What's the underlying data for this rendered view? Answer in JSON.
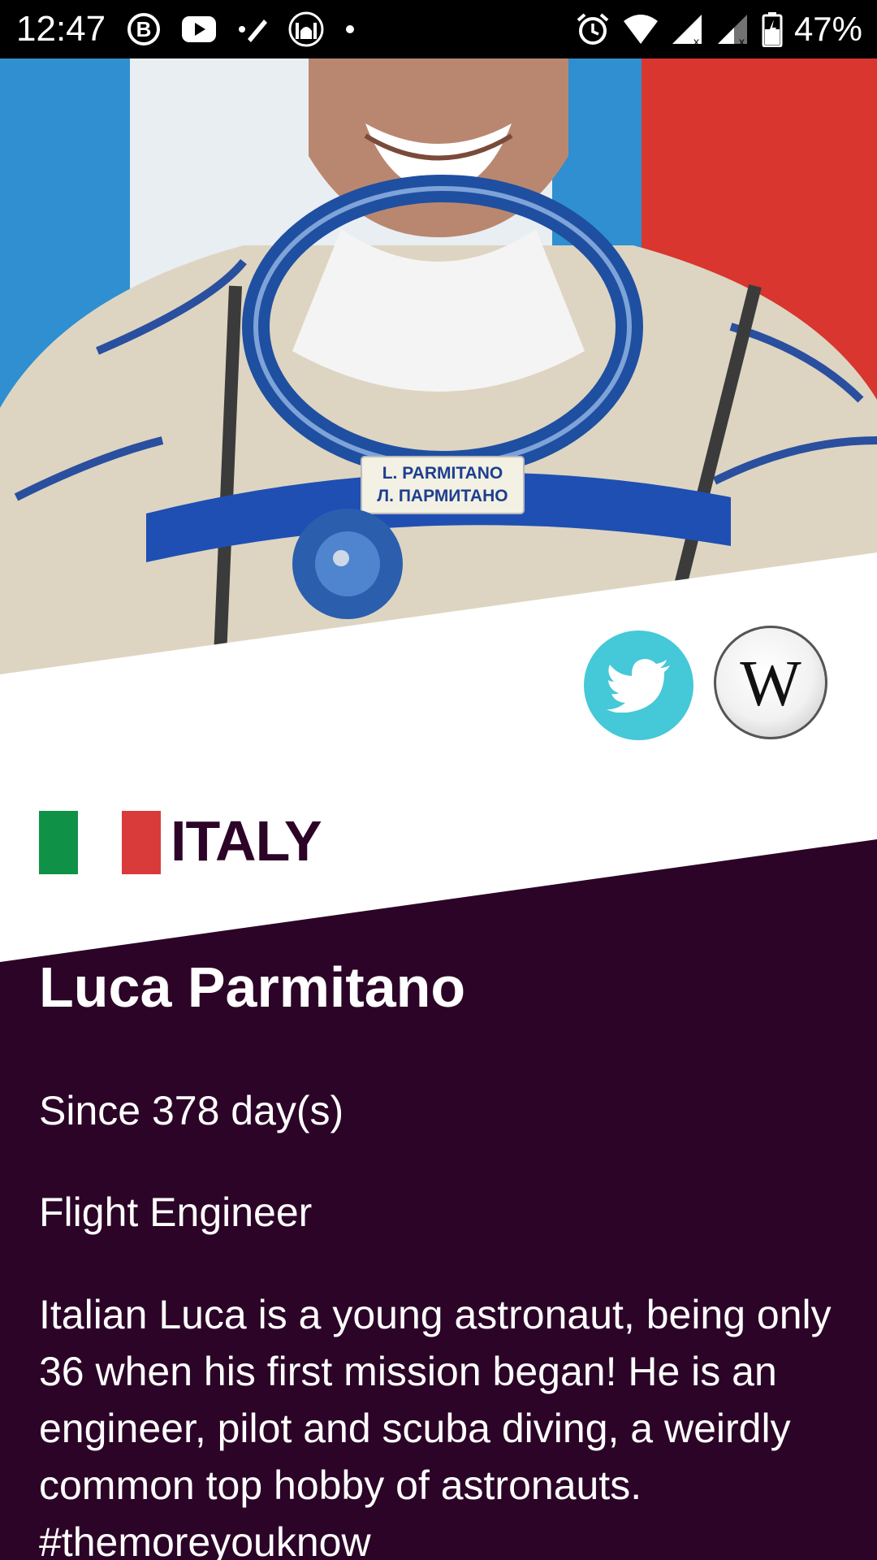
{
  "status_bar": {
    "time": "12:47",
    "battery": "47%",
    "left_icons": [
      "b-badge-icon",
      "youtube-icon",
      "pen-icon",
      "mosque-icon",
      "dot-icon"
    ],
    "right_icons": [
      "alarm-icon",
      "wifi-icon",
      "signal-icon",
      "signal-icon",
      "battery-icon"
    ]
  },
  "hero": {
    "nametag_line1": "L. PARMITANO",
    "nametag_line2": "Л. ПАРМИТАНО"
  },
  "social": {
    "twitter_icon": "twitter-bird-icon",
    "wiki_label": "W"
  },
  "country": {
    "name": "ITALY",
    "flag_colors": [
      "#0f9247",
      "#ffffff",
      "#d93a3a"
    ]
  },
  "astronaut": {
    "name": "Luca Parmitano",
    "since": "Since 378 day(s)",
    "role": "Flight Engineer",
    "bio": "Italian Luca is a young astronaut, being only 36 when his first mission began! He is an engineer, pilot and scuba diving, a weirdly common top hobby of astronauts. #themoreyouknow"
  },
  "colors": {
    "dark_background": "#2c0427",
    "twitter_accent": "#45c8d8",
    "white_band": "#ffffff"
  }
}
